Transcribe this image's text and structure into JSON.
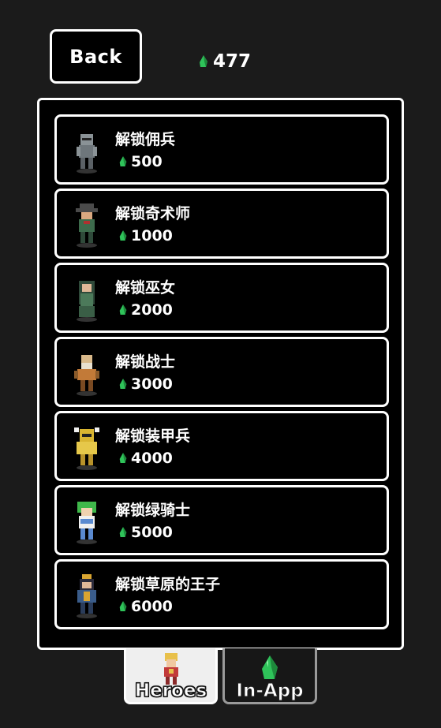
{
  "header": {
    "back_label": "Back",
    "currency_amount": "477"
  },
  "shop_items": [
    {
      "name": "解锁佣兵",
      "price": "500",
      "hero_icon": "mercenary-icon",
      "colors": {
        "main": "#8a9296",
        "accent": "#5b6166"
      }
    },
    {
      "name": "解锁奇术师",
      "price": "1000",
      "hero_icon": "magician-icon",
      "colors": {
        "main": "#3d6b4c",
        "accent": "#4a4a4a"
      }
    },
    {
      "name": "解锁巫女",
      "price": "2000",
      "hero_icon": "shrine-maiden-icon",
      "colors": {
        "main": "#4c7a5a",
        "accent": "#2f4a3a"
      }
    },
    {
      "name": "解锁战士",
      "price": "3000",
      "hero_icon": "warrior-icon",
      "colors": {
        "main": "#c27a38",
        "accent": "#d9b98a"
      }
    },
    {
      "name": "解锁装甲兵",
      "price": "4000",
      "hero_icon": "armored-soldier-icon",
      "colors": {
        "main": "#d9b531",
        "accent": "#f0f0f0"
      }
    },
    {
      "name": "解锁绿骑士",
      "price": "5000",
      "hero_icon": "green-knight-icon",
      "colors": {
        "main": "#3fb84a",
        "accent": "#5a8ad0"
      }
    },
    {
      "name": "解锁草原的王子",
      "price": "6000",
      "hero_icon": "steppe-prince-icon",
      "colors": {
        "main": "#3a5c8a",
        "accent": "#d9a531"
      }
    }
  ],
  "tabs": [
    {
      "label": "Heroes",
      "icon": "hero-tab-icon",
      "active": true
    },
    {
      "label": "In-App",
      "icon": "gem-tab-icon",
      "active": false
    }
  ],
  "colors": {
    "background": "#1b1b1b",
    "gem": "#2fc35a",
    "active_tab": "#efefef"
  }
}
